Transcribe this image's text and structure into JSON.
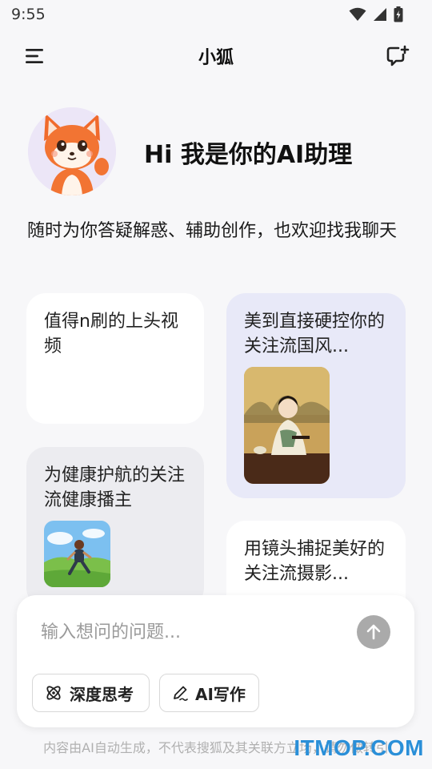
{
  "status_bar": {
    "time": "9:55",
    "icons": [
      "wifi-icon",
      "signal-icon",
      "battery-icon"
    ]
  },
  "header": {
    "title": "小狐",
    "menu_icon": "menu-icon",
    "new_chat_icon": "new-chat-icon"
  },
  "hero": {
    "greeting": "Hi 我是你的AI助理",
    "intro": "随时为你答疑解惑、辅助创作，也欢迎找我聊天"
  },
  "cards": [
    {
      "text": "值得n刷的上头视频"
    },
    {
      "text": "美到直接硬控你的关注流国风..."
    },
    {
      "text": "为健康护航的关注流健康播主"
    },
    {
      "text": "用镜头捕捉美好的关注流摄影..."
    }
  ],
  "composer": {
    "placeholder": "输入想问的问题...",
    "chips": [
      {
        "label": "深度思考",
        "icon": "atom-icon"
      },
      {
        "label": "AI写作",
        "icon": "pen-icon"
      }
    ]
  },
  "footer": {
    "disclaimer": "内容由AI自动生成，不代表搜狐及其关联方立场，请勿做转引",
    "watermark": "ITMOP.COM"
  },
  "colors": {
    "background": "#f7f7f9",
    "card_highlight": "#e8e9f8",
    "card_grey": "#ececf0",
    "send_button": "#aaaaaa",
    "watermark": "#2a8fd8"
  }
}
